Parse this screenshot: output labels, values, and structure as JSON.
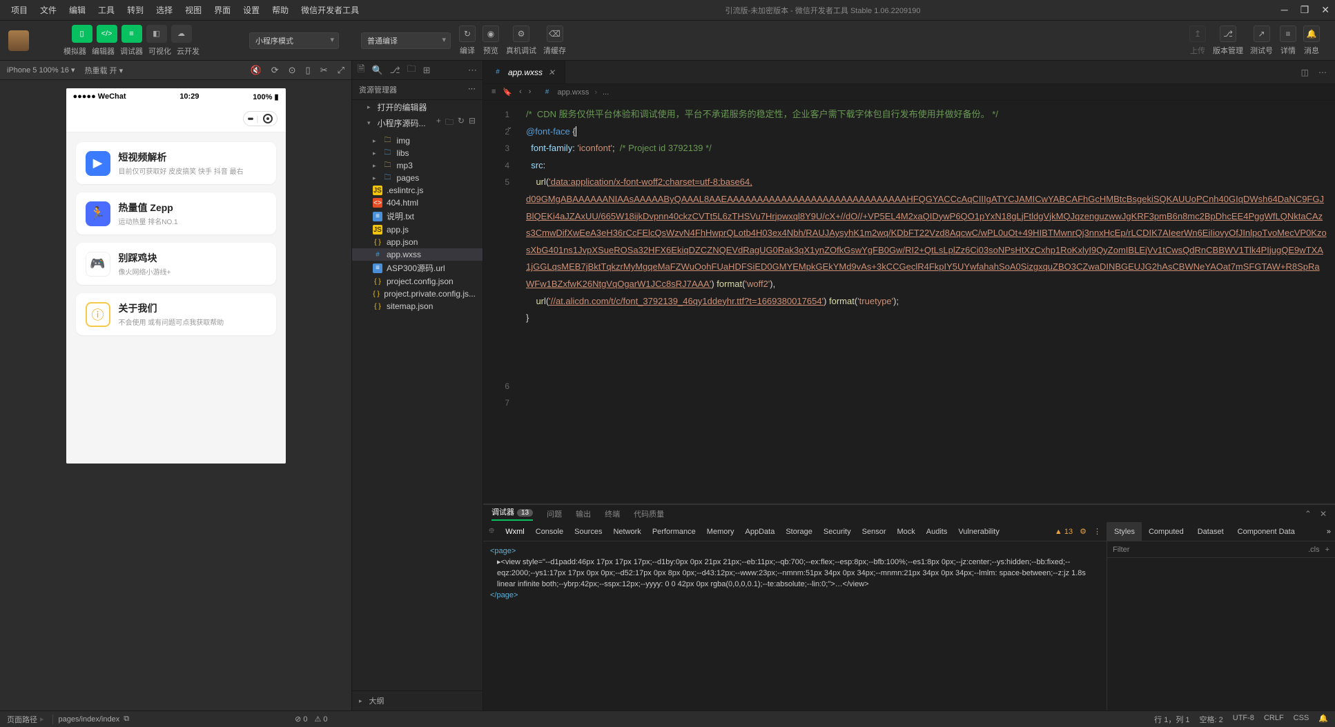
{
  "menus": [
    "项目",
    "文件",
    "编辑",
    "工具",
    "转到",
    "选择",
    "视图",
    "界面",
    "设置",
    "帮助",
    "微信开发者工具"
  ],
  "title_center": "引流版-未加密版本 - 微信开发者工具 Stable 1.06.2209190",
  "toolbar": {
    "sim_label": "模拟器",
    "editor_label": "编辑器",
    "debugger_label": "调试器",
    "visual_label": "可视化",
    "cloud_label": "云开发",
    "mode": "小程序模式",
    "compile_select": "普通编译",
    "compile_label": "编译",
    "preview_label": "预览",
    "rdebug_label": "真机调试",
    "cache_label": "清缓存",
    "upload_label": "上传",
    "version_label": "版本管理",
    "testacc_label": "测试号",
    "detail_label": "详情",
    "msg_label": "消息"
  },
  "sim": {
    "device": "iPhone 5 100% 16",
    "hot": "热重载 开"
  },
  "phone": {
    "carrier": "●●●●● WeChat",
    "signal": "📶",
    "time": "10:29",
    "battery": "100%",
    "cards": [
      {
        "title": "短视频解析",
        "sub": "目前仅可获取好 皮皮搞笑 快手 抖音 最右",
        "icon": "▶",
        "cls": "ci-blue"
      },
      {
        "title": "热量值 Zepp",
        "sub": "运动热量 排名NO.1",
        "icon": "🏃",
        "cls": "ci-blue2"
      },
      {
        "title": "别踩鸡块",
        "sub": "像火网络小游线+",
        "icon": "🎮",
        "cls": "ci-game"
      },
      {
        "title": "关于我们",
        "sub": "不会使用 或有问题可点我获取帮助",
        "icon": "ⓘ",
        "cls": "ci-yellow"
      }
    ]
  },
  "explorer": {
    "header": "资源管理器",
    "opened": "打开的编辑器",
    "project": "小程序源码...",
    "files": [
      {
        "name": "img",
        "type": "folder",
        "lv": 1
      },
      {
        "name": "libs",
        "type": "folder-blue",
        "lv": 1
      },
      {
        "name": "mp3",
        "type": "folder",
        "lv": 1
      },
      {
        "name": "pages",
        "type": "folder-blue",
        "lv": 1
      },
      {
        "name": ".eslintrc.js",
        "type": "js",
        "lv": 1
      },
      {
        "name": "404.html",
        "type": "html",
        "lv": 1
      },
      {
        "name": "说明.txt",
        "type": "txt",
        "lv": 1
      },
      {
        "name": "app.js",
        "type": "js",
        "lv": 1
      },
      {
        "name": "app.json",
        "type": "json",
        "lv": 1
      },
      {
        "name": "app.wxss",
        "type": "css",
        "lv": 1,
        "sel": true
      },
      {
        "name": "ASP300源码.url",
        "type": "txt",
        "lv": 1
      },
      {
        "name": "project.config.json",
        "type": "json",
        "lv": 1
      },
      {
        "name": "project.private.config.js...",
        "type": "json",
        "lv": 1
      },
      {
        "name": "sitemap.json",
        "type": "json",
        "lv": 1
      }
    ],
    "outline": "大纲"
  },
  "editor": {
    "tab_name": "app.wxss",
    "breadcrumb": [
      "app.wxss",
      "..."
    ],
    "lines": [
      "1",
      "2",
      "3",
      "4",
      "5",
      "",
      "",
      "",
      "",
      "",
      "",
      "",
      "",
      "",
      "",
      "",
      "6",
      "7"
    ],
    "l1": "/*  CDN 服务仅供平台体验和调试使用，平台不承诺服务的稳定性，企业客户需下载字体包自行发布使用并做好备份。 */",
    "l2a": "@font-face",
    "l2b": " {",
    "l3a": "font-family",
    "l3b": ": ",
    "l3c": "'iconfont'",
    "l3d": ";  ",
    "l3e": "/* Project id 3792139 */",
    "l4a": "src",
    "l4b": ":",
    "l5a": "url",
    "l5b": "(",
    "l5c": "'data:application/x-font-woff2;charset=utf-8;base64,",
    "l5_long": "d09GMgABAAAAAANIAAsAAAAAByQAAAL8AAEAAAAAAAAAAAAAAAAAAAAAAAAAAAAAAHFQGYACCcAqCIIIgATYCJAMICwYABCAFhGcHMBtcBsgekiSQKAUUoPCnh40GIqDWsh64DaNC9FGJBlQEKi4aJZAxUU/665W18ijkDvpnn40ckzCVTt5L6zTHSVu7Hrjpwxql8Y9U/cX+//dO//+VP5EL4M2xaQIDywP6QO1pYxN18gLjFtldgVjkMQJqzenguzwwJgKRF3pmB6n8mc2BpDhcEE4PggWfLQNktaCAzs3CmwDifXwEeA3eH36rCcFElcQsWzvN4FhHwprQLotb4H03ex4Nbh/RAUJAysyhK1m2wq/KDbFT22Vzd8AqcwC/wPL0uOt+49HIBTMwnrQj3nnxHcEp/rLCDIK7AIeerWn6EiIiovyOfJInlpoTvoMecVP0KzosXbG401ns1JvpXSueROSa32HFX6EkiqDZCZNQEVdRagUG0Rak3qX1ynZOfkGswYgFB0Gw/RI2+QtLsLplZz6Ci03soNPsHtXzCxhp1RoKxlyI9QyZomIBLEjVv1tCwsQdRnCBBWV1Tlk4PIjugQE9wTXA1jGGLqsMEB7jBktTqkzrMyMgqeMaFZWuOohFUaHDFSiED0GMYEMpkGEkYMd9vAs+3kCCGeclR4FkpIY5UYwfahahSoA0SizgxquZBO3CZwaDINBGEUJG2hAsCBWNeYAOat7mSFGTAW+R8SpRaWFw1BZxfwK26NtgVqOgarW1JCc8sRJ7AAA'",
    "l5d": ") ",
    "l5e": "format",
    "l5f": "(",
    "l5g": "'woff2'",
    "l5h": "),",
    "l6a": "url",
    "l6b": "(",
    "l6c": "'//at.alicdn.com/t/c/font_3792139_46qy1ddeyhr.ttf?t=1669380017654'",
    "l6d": ") ",
    "l6e": "format",
    "l6f": "(",
    "l6g": "'truetype'",
    "l6h": ");",
    "l7": "}"
  },
  "dbg_top": {
    "tabs": [
      "调试器",
      "问题",
      "输出",
      "终端",
      "代码质量"
    ],
    "badge": "13"
  },
  "dbg": {
    "tabs": [
      "Wxml",
      "Console",
      "Sources",
      "Network",
      "Performance",
      "Memory",
      "AppData",
      "Storage",
      "Security",
      "Sensor",
      "Mock",
      "Audits",
      "Vulnerability"
    ],
    "warn_count": "13",
    "wxml_open": "<page>",
    "wxml_view": "▸<view style=\"--d1padd:46px 17px 17px 17px;--d1by:0px 0px 21px 21px;--eb:11px;--qb:700;--ex:flex;--esp:8px;--bfb:100%;--es1:8px 0px;--jz:center;--ys:hidden;--bb:fixed;--eqz:2000;--ys1:17px 17px 0px 0px;--d52:17px 0px 8px 0px;--d43:12px;--www:23px;--nmnm:51px 34px 0px 34px;--mnmn:21px 34px 0px 34px;--lmlm: space-between;--z:jz 1.8s linear infinite both;--ybrp:42px;--sspx:12px;--yyyy: 0 0 42px 0px rgba(0,0,0,0.1);--te:absolute;--lin:0;\">…</view>",
    "wxml_close": "</page>",
    "right_tabs": [
      "Styles",
      "Computed",
      "Dataset",
      "Component Data"
    ],
    "filter": "Filter",
    "cls": ".cls"
  },
  "status": {
    "page_path_label": "页面路径",
    "page_path": "pages/index/index",
    "err": "0",
    "warn": "0",
    "pos": "行 1，列 1",
    "space": "空格: 2",
    "enc": "UTF-8",
    "eol": "CRLF",
    "lang": "CSS"
  }
}
